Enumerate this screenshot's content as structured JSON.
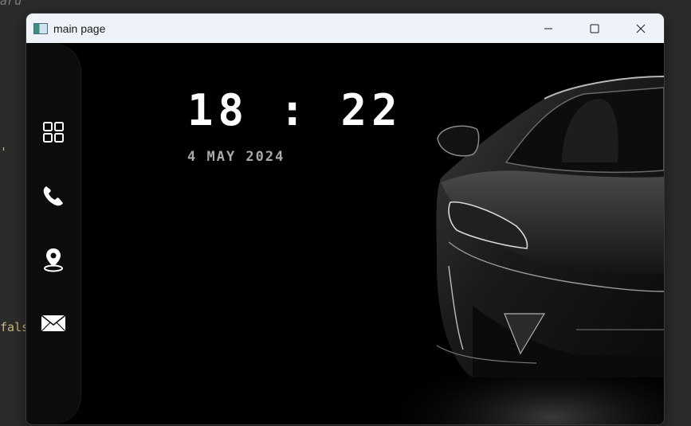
{
  "background_editor": {
    "fragment_top": "ard",
    "fragment_mid": "'",
    "fragment_low": "fals"
  },
  "window": {
    "title": "main page",
    "controls": {
      "minimize_icon": "minimize-icon",
      "maximize_icon": "maximize-icon",
      "close_icon": "close-icon"
    }
  },
  "sidebar": {
    "items": [
      {
        "name": "dashboard",
        "icon": "grid-icon"
      },
      {
        "name": "phone",
        "icon": "phone-icon"
      },
      {
        "name": "location",
        "icon": "location-pin-icon"
      },
      {
        "name": "mail",
        "icon": "mail-icon"
      }
    ]
  },
  "main": {
    "time": "18 : 22",
    "date": "4 MAY 2024",
    "background_image": "black-sports-car"
  },
  "colors": {
    "sidebar_bg": "#0b0c0d",
    "content_bg": "#000000",
    "time_color": "#ffffff",
    "date_color": "#a9a9a9",
    "titlebar_bg": "#eef3f9"
  }
}
